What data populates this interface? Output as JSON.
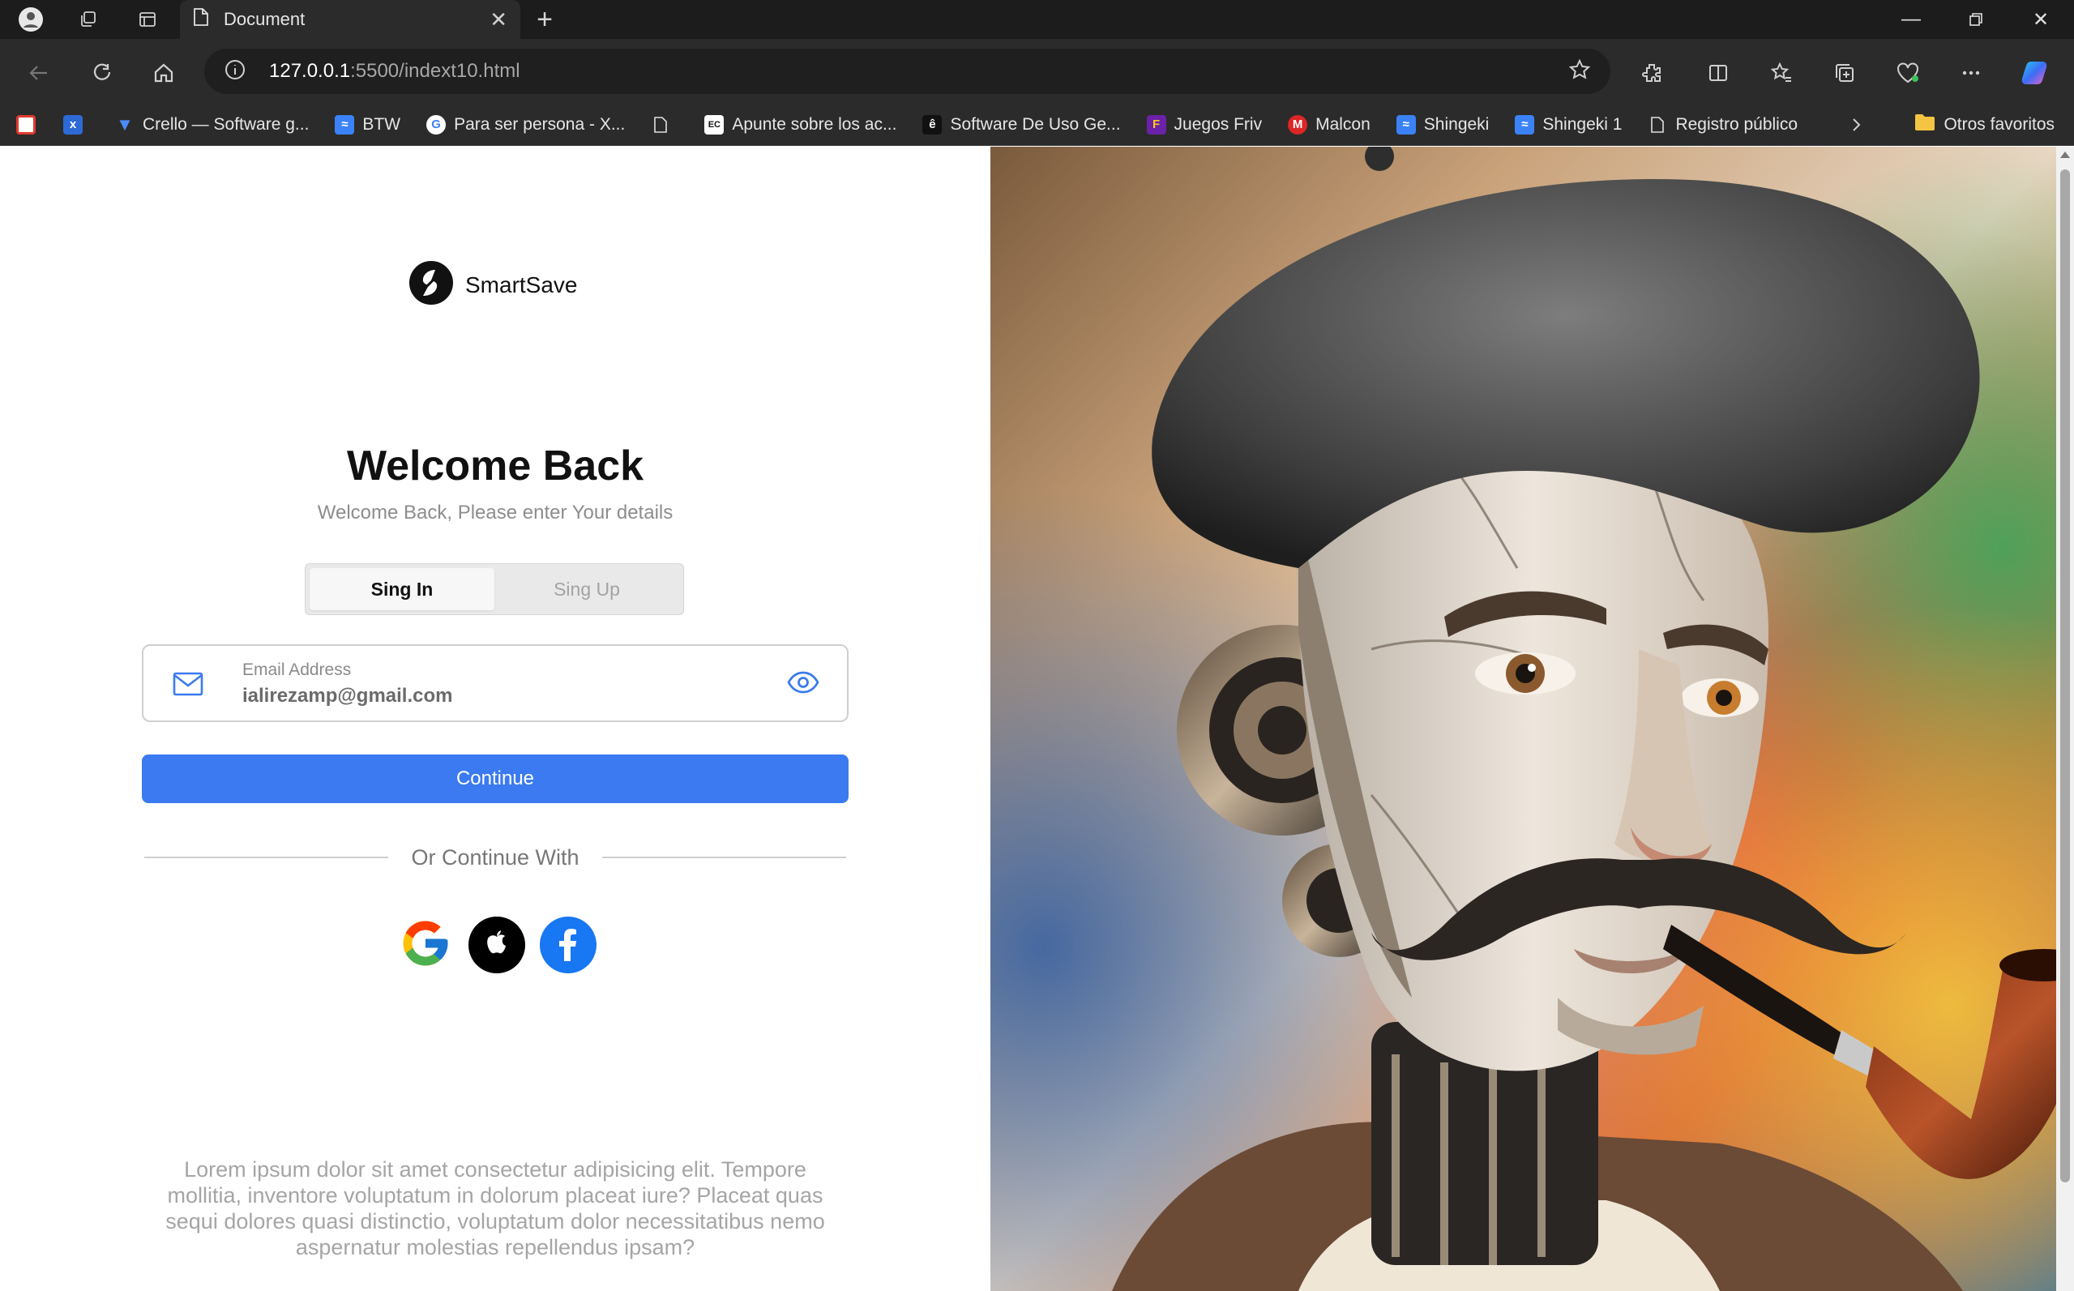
{
  "browser": {
    "tab_title": "Document",
    "url_host": "127.0.0.1",
    "url_rest": ":5500/indext10.html",
    "bookmarks": [
      {
        "label": "",
        "icon": "opera-icon",
        "color": "#e03a2f"
      },
      {
        "label": "",
        "icon": "x-icon",
        "color": "#2d6ad6"
      },
      {
        "label": "Crello — Software g...",
        "icon": "crello-icon",
        "color": "#2563eb"
      },
      {
        "label": "BTW",
        "icon": "btw-icon",
        "color": "#3b82f6"
      },
      {
        "label": "Para ser persona - X...",
        "icon": "google-icon",
        "color": "#ffffff"
      },
      {
        "label": "",
        "icon": "page-icon",
        "color": "#2b2b2b"
      },
      {
        "label": "Apunte sobre los ac...",
        "icon": "ec-icon",
        "color": "#ffffff"
      },
      {
        "label": "Software De Uso Ge...",
        "icon": "e-icon",
        "color": "#111111"
      },
      {
        "label": "Juegos Friv",
        "icon": "friv-icon",
        "color": "#6b21a8"
      },
      {
        "label": "Malcon",
        "icon": "m-icon",
        "color": "#dc2626"
      },
      {
        "label": "Shingeki",
        "icon": "shingeki-icon",
        "color": "#3b82f6"
      },
      {
        "label": "Shingeki 1",
        "icon": "shingeki-icon",
        "color": "#3b82f6"
      },
      {
        "label": "Registro público",
        "icon": "page-icon",
        "color": "#2b2b2b"
      }
    ],
    "others_label": "Otros favoritos"
  },
  "brand": {
    "name": "SmartSave"
  },
  "login": {
    "title": "Welcome Back",
    "subtitle": "Welcome Back, Please enter Your details",
    "tab_signin": "Sing In",
    "tab_signup": "Sing Up",
    "email_label": "Email Address",
    "email_value": "ialirezamp@gmail.com",
    "continue_label": "Continue",
    "divider_text": "Or Continue With",
    "footer_text": "Lorem ipsum dolor sit amet consectetur adipisicing elit. Tempore mollitia, inventore voluptatum in dolorum placeat iure? Placeat quas sequi dolores quasi distinctio, voluptatum dolor necessitatibus nemo aspernatur molestias repellendus ipsam?"
  },
  "colors": {
    "accent": "#3b7af0",
    "facebook": "#1877f2"
  }
}
